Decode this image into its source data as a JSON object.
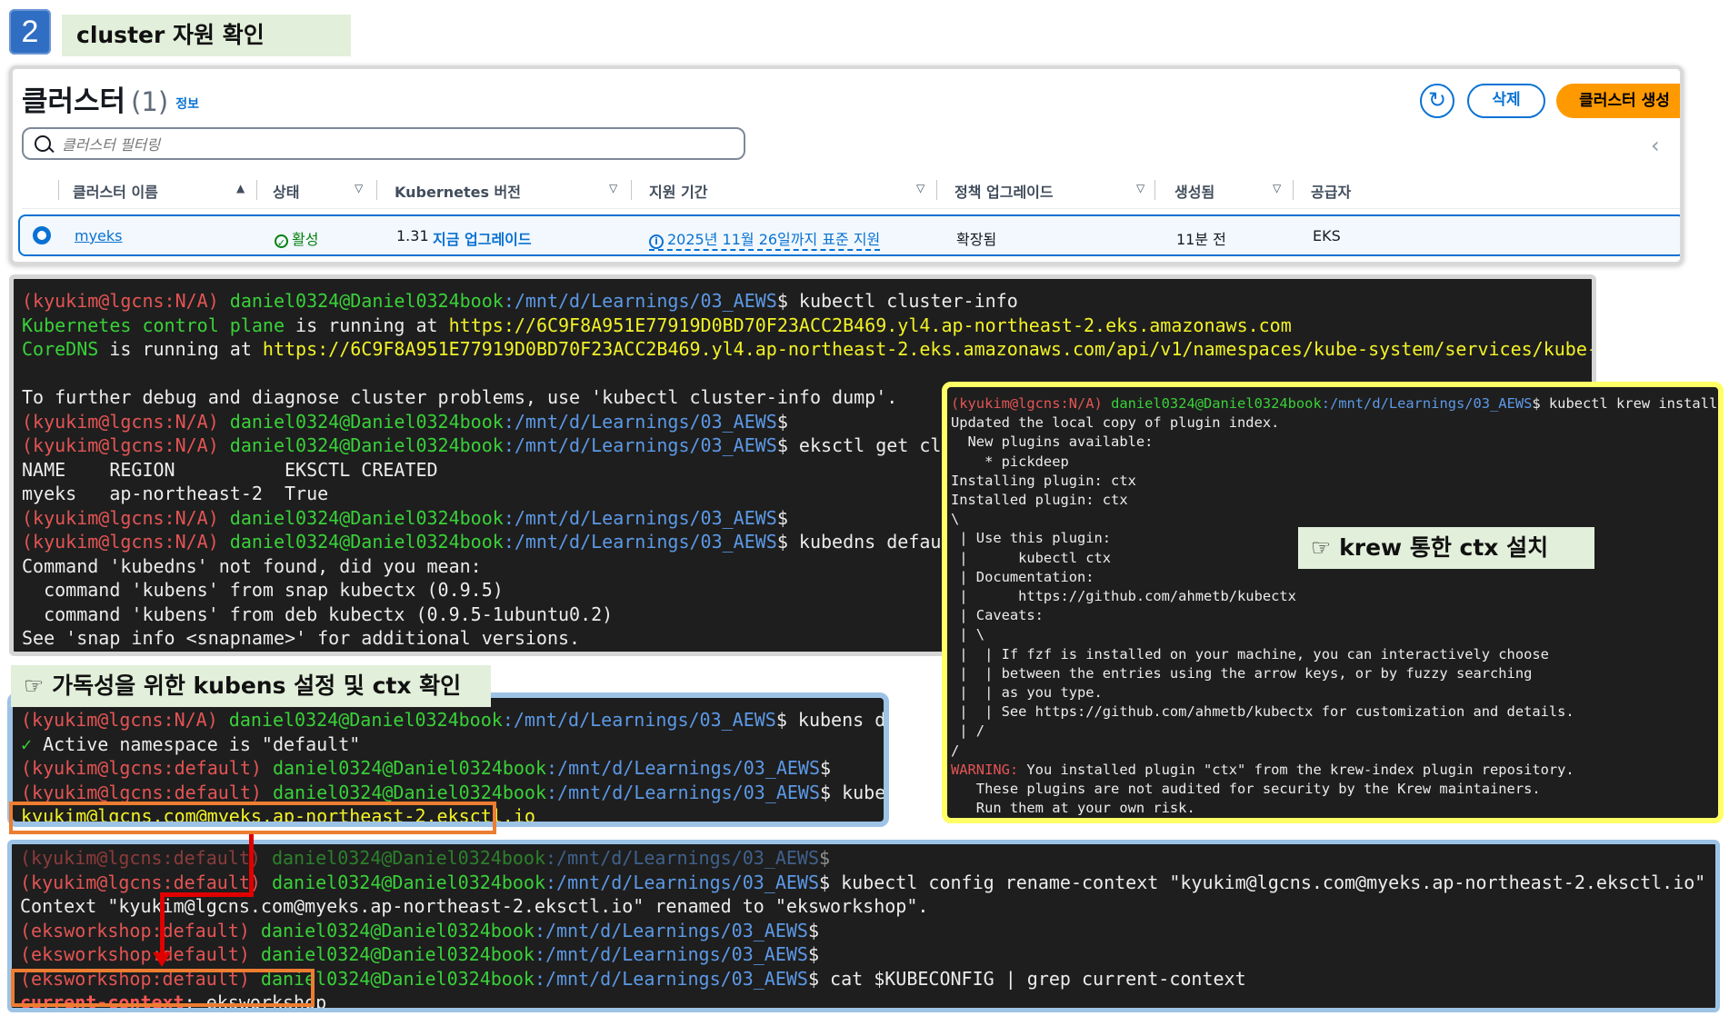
{
  "step": {
    "number": "2",
    "title": "cluster 자원 확인"
  },
  "console": {
    "title": "클러스터",
    "count": "(1)",
    "info_link": "정보",
    "refresh_icon": "↻",
    "delete_label": "삭제",
    "create_label": "클러스터 생성",
    "filter_placeholder": "클러스터 필터링",
    "pager_prev": "‹",
    "columns": [
      "클러스터 이름",
      "상태",
      "Kubernetes 버전",
      "지원 기간",
      "정책 업그레이드",
      "생성됨",
      "공급자"
    ],
    "row": {
      "name": "myeks",
      "status": "활성",
      "k8s_version": "1.31",
      "upgrade_link": "지금 업그레이드",
      "support": "2025년 11월 26일까지 표준 지원",
      "policy": "확장됨",
      "created": "11분 전",
      "provider": "EKS"
    }
  },
  "terminal1": {
    "prompt_user": "(kyukim@lgcns:N/A) ",
    "prompt_host": "daniel0324@Daniel0324book",
    "prompt_path": ":/mnt/d/Learnings/03_AEWS",
    "prompt_end": "$",
    "cmd1": " kubectl cluster-info",
    "k8s_label": "Kubernetes control plane",
    "running_at": " is running at ",
    "k8s_url": "https://6C9F8A951E77919D0BD70F23ACC2B469.yl4.ap-northeast-2.eks.amazonaws.com",
    "coredns_label": "CoreDNS",
    "coredns_url": "https://6C9F8A951E77919D0BD70F23ACC2B469.yl4.ap-northeast-2.eks.amazonaws.com/api/v1/namespaces/kube-system/services/kube-dns:dns/proxy",
    "debug_line": "To further debug and diagnose cluster problems, use 'kubectl cluster-info dump'.",
    "cmd2": " eksctl get cluster",
    "table_header": "NAME    REGION          EKSCTL CREATED",
    "table_row": "myeks   ap-northeast-2  True",
    "cmd3": " kubedns default",
    "not_found": "Command 'kubedns' not found, did you mean:",
    "suggest1": "  command 'kubens' from snap kubectx (0.9.5)",
    "suggest2": "  command 'kubens' from deb kubectx (0.9.5-1ubuntu0.2)",
    "see_snap": "See 'snap info <snapname>' for additional versions."
  },
  "terminal2": {
    "prompt_user": "(kyukim@lgcns:N/A) ",
    "prompt_host": "daniel0324@Daniel0324book",
    "prompt_path": ":/mnt/d/Learnings/03_AEWS",
    "cmd": "$ kubectl krew install ctx",
    "lines": [
      "Updated the local copy of plugin index.",
      "  New plugins available:",
      "    * pickdeep",
      "Installing plugin: ctx",
      "Installed plugin: ctx",
      "\\",
      " | Use this plugin:",
      " |      kubectl ctx",
      " | Documentation:",
      " |      https://github.com/ahmetb/kubectx",
      " | Caveats:",
      " | \\",
      " |  | If fzf is installed on your machine, you can interactively choose",
      " |  | between the entries using the arrow keys, or by fuzzy searching",
      " |  | as you type.",
      " |  | See https://github.com/ahmetb/kubectx for customization and details.",
      " | /",
      "/"
    ],
    "warning_label": "WARNING:",
    "warning_text": " You installed plugin \"ctx\" from the krew-index plugin repository.",
    "warning_l2": "   These plugins are not audited for security by the Krew maintainers.",
    "warning_l3": "   Run them at your own risk."
  },
  "callout_ctx": "☞ krew 통한 ctx 설치",
  "callout_kubens": "☞ 가독성을 위한 kubens 설정 및 ctx 확인",
  "terminal3": {
    "prompt_user": "(kyukim@lgcns:N/A) ",
    "prompt_user_default": "(kyukim@lgcns:default) ",
    "prompt_host": "daniel0324@Daniel0324book",
    "prompt_path": ":/mnt/d/Learnings/03_AEWS",
    "cmd1": "$ kubens default",
    "check": "✓",
    "active_ns": " Active namespace is \"default\"",
    "cmd2": "$ kubectl ctx",
    "context_output": "kyukim@lgcns.com@myeks.ap-northeast-2.eksctl.io"
  },
  "terminal4": {
    "prompt_user_default": "(kyukim@lgcns:default) ",
    "prompt_ws": "(eksworkshop:default) ",
    "prompt_host": "daniel0324@Daniel0324book",
    "prompt_path": ":/mnt/d/Learnings/03_AEWS",
    "cmd_rename": "$ kubectl config rename-context \"kyukim@lgcns.com@myeks.ap-northeast-2.eksctl.io\" \"eksworkshop\"",
    "renamed": "Context \"kyukim@lgcns.com@myeks.ap-northeast-2.eksctl.io\" renamed to \"eksworkshop\".",
    "cmd_cat": "$ cat $KUBECONFIG | grep current-context",
    "current_label": "current-context",
    "current_value": ": eksworkshop"
  }
}
